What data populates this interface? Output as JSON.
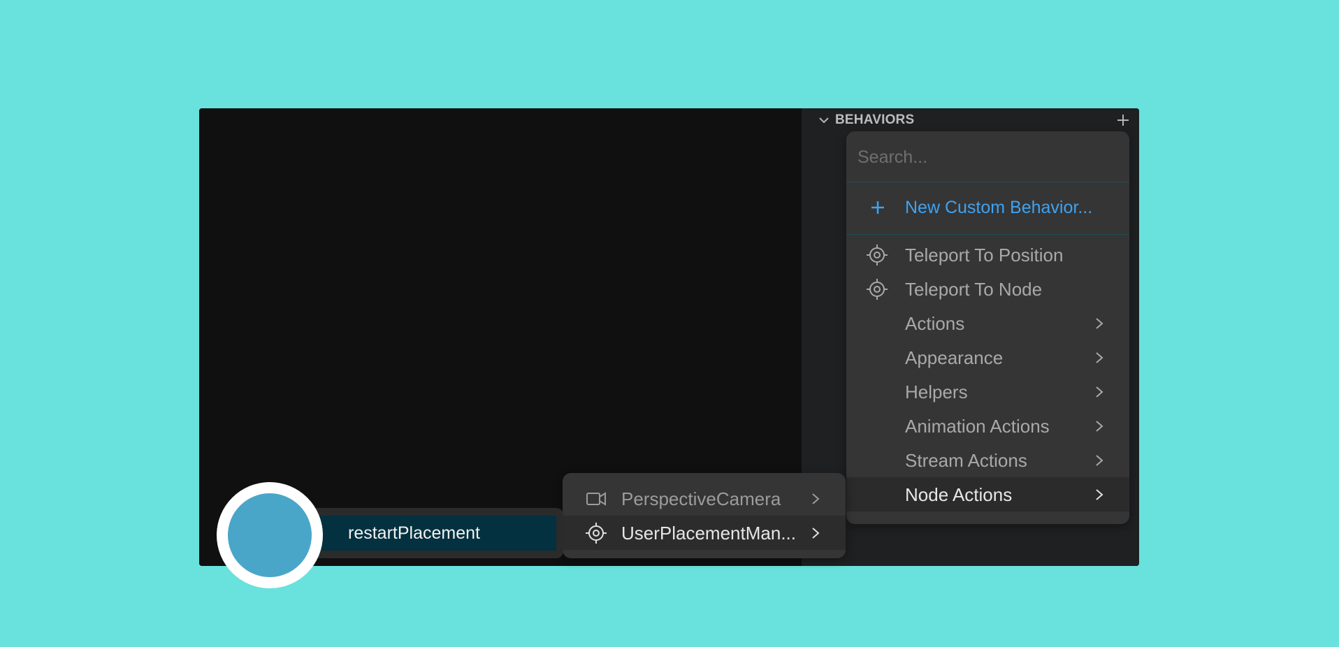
{
  "panel": {
    "title": "BEHAVIORS",
    "collapse_icon": "chevron-down-icon",
    "add_icon": "plus-icon"
  },
  "menu": {
    "search_placeholder": "Search...",
    "new_custom_label": "New Custom Behavior...",
    "items": [
      {
        "label": "Teleport To Position",
        "icon": "target-icon",
        "submenu": false
      },
      {
        "label": "Teleport To Node",
        "icon": "target-icon",
        "submenu": false
      },
      {
        "label": "Actions",
        "submenu": true
      },
      {
        "label": "Appearance",
        "submenu": true
      },
      {
        "label": "Helpers",
        "submenu": true
      },
      {
        "label": "Animation Actions",
        "submenu": true
      },
      {
        "label": "Stream Actions",
        "submenu": true
      },
      {
        "label": "Node Actions",
        "submenu": true,
        "active": true
      }
    ]
  },
  "submenu": {
    "items": [
      {
        "label": "PerspectiveCamera",
        "icon": "video-camera-icon"
      },
      {
        "label": "UserPlacementMan...",
        "icon": "target-icon",
        "active": true
      }
    ]
  },
  "node": {
    "label": "restartPlacement"
  },
  "colors": {
    "background": "#69e2dd",
    "accent": "#3fa2f0",
    "highlight": "#03313f"
  }
}
